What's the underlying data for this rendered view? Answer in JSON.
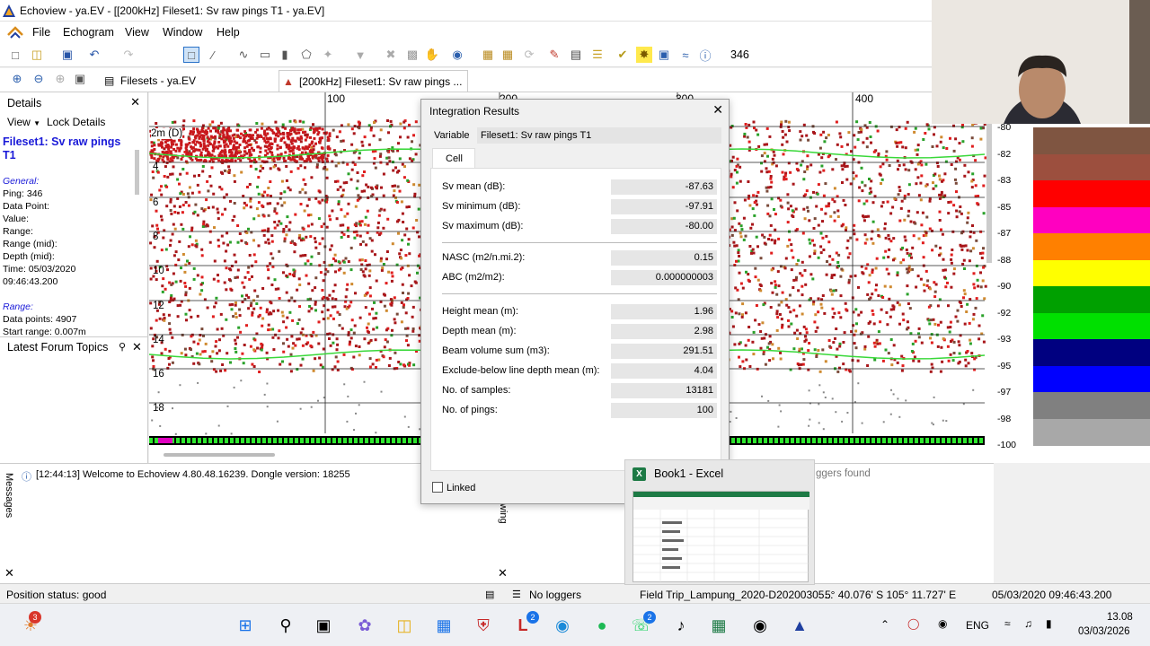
{
  "window": {
    "title": "Echoview - ya.EV - [[200kHz] Fileset1: Sv raw pings T1 - ya.EV]"
  },
  "menu": [
    "File",
    "Echogram",
    "View",
    "Window",
    "Help"
  ],
  "toolbar": {
    "ping_count": "346"
  },
  "tabs": [
    {
      "label": "Filesets - ya.EV"
    },
    {
      "label": "[200kHz] Fileset1: Sv raw pings ..."
    }
  ],
  "details": {
    "header": "Details",
    "view_label": "View",
    "lock_label": "Lock Details",
    "fileset": "Fileset1: Sv raw pings T1",
    "general_header": "General:",
    "lines": [
      "Ping: 346",
      "Data Point:",
      "Value:",
      "Range:",
      "Range (mid):",
      "Depth (mid):",
      "Time: 05/03/2020",
      "09:46:43.200"
    ],
    "range_header": "Range:",
    "range_lines": [
      "Data points: 4907",
      "Start range: 0.007m"
    ],
    "forum_header": "Latest Forum Topics"
  },
  "echogram": {
    "x_labels": [
      "100",
      "200",
      "300",
      "400"
    ],
    "grid_label": "2m (D)",
    "depth_labels": [
      "4",
      "6",
      "8",
      "10",
      "12",
      "14",
      "16",
      "18"
    ]
  },
  "color_scale": {
    "labels": [
      "-80",
      "-82",
      "-83",
      "-85",
      "-87",
      "-88",
      "-90",
      "-92",
      "-93",
      "-95",
      "-97",
      "-98",
      "-100"
    ],
    "colors": [
      "#7f5541",
      "#9c4f3e",
      "#ff0000",
      "#ff00c0",
      "#ff8000",
      "#ffff00",
      "#00a000",
      "#00e000",
      "#000080",
      "#0000ff",
      "#808080",
      "#a8a8a8"
    ]
  },
  "messages": {
    "side_label": "Messages",
    "text": "[12:44:13] Welcome to Echoview 4.80.48.16239. Dongle version: 18255",
    "loggers_found": "ggers found",
    "side_label2": "wing"
  },
  "status": {
    "position": "Position status: good",
    "loggers": "No loggers",
    "file": "Field Trip_Lampung_2020-D20200305...",
    "coords": "5° 40.076' S 105° 11.727' E",
    "datetime": "05/03/2020 09:46:43.200"
  },
  "dialog": {
    "title": "Integration Results",
    "variable_label": "Variable",
    "variable_value": "Fileset1: Sv raw pings T1",
    "tab": "Cell",
    "rows": [
      {
        "label": "Sv mean (dB):",
        "value": "-87.63"
      },
      {
        "label": "Sv minimum (dB):",
        "value": "-97.91"
      },
      {
        "label": "Sv maximum (dB):",
        "value": "-80.00"
      },
      {
        "label": "NASC (m2/n.mi.2):",
        "value": "0.15"
      },
      {
        "label": "ABC (m2/m2):",
        "value": "0.000000003"
      },
      {
        "label": "Height mean (m):",
        "value": "1.96"
      },
      {
        "label": "Depth mean (m):",
        "value": "2.98"
      },
      {
        "label": "Beam volume sum (m3):",
        "value": "291.51"
      },
      {
        "label": "Exclude-below line depth mean (m):",
        "value": "4.04"
      },
      {
        "label": "No. of samples:",
        "value": "13181"
      },
      {
        "label": "No. of pings:",
        "value": "100"
      }
    ],
    "linked_label": "Linked"
  },
  "excel_popup": {
    "title": "Book1 - Excel"
  },
  "taskbar": {
    "badges": {
      "weather": "3",
      "office": "2",
      "whatsapp": "2"
    },
    "lang": "ENG",
    "time": "13.08",
    "date": "03/03/2026"
  }
}
